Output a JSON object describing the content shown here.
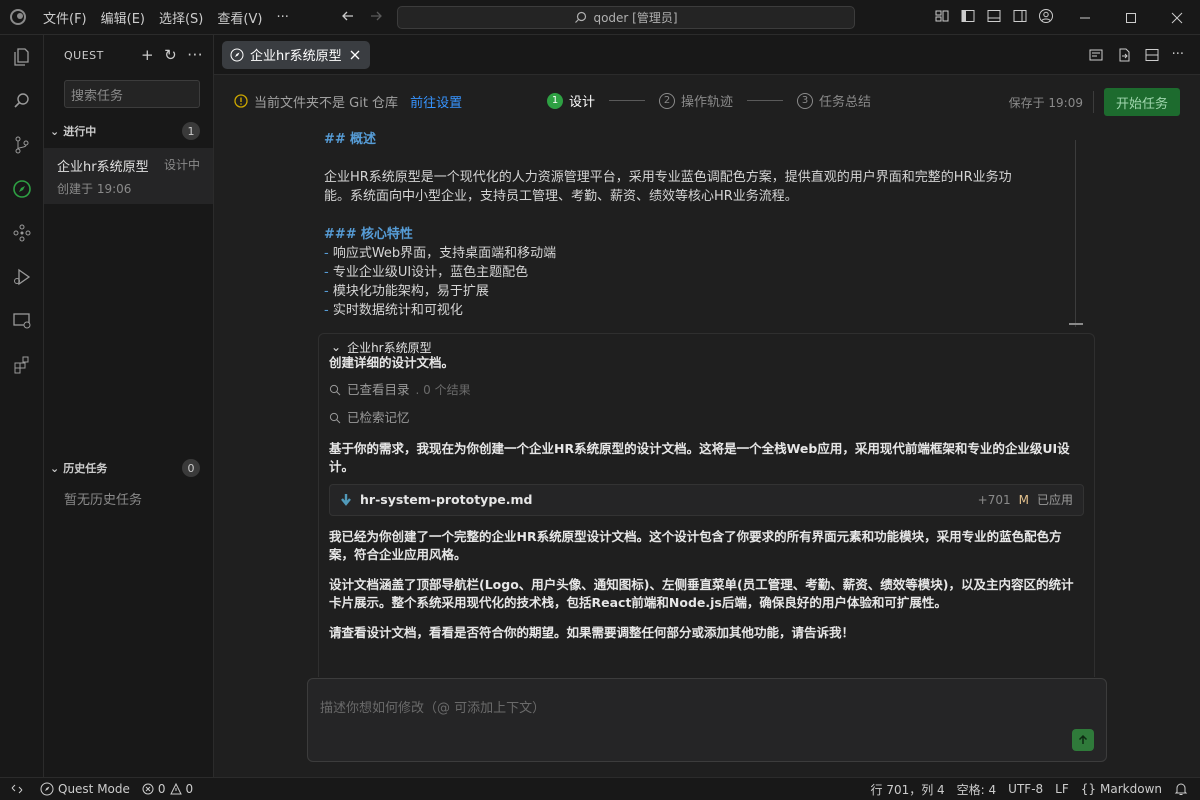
{
  "titlebar": {
    "menu": [
      "文件(F)",
      "编辑(E)",
      "选择(S)",
      "查看(V)",
      "···"
    ],
    "search": "qoder [管理员]"
  },
  "sidebar": {
    "title": "QUEST",
    "search_placeholder": "搜索任务",
    "in_progress": {
      "label": "进行中",
      "count": "1"
    },
    "task": {
      "name": "企业hr系统原型",
      "status": "设计中",
      "created": "创建于 19:06"
    },
    "history": {
      "label": "历史任务",
      "count": "0",
      "empty": "暂无历史任务"
    }
  },
  "tab": {
    "label": "企业hr系统原型"
  },
  "stepbar": {
    "git_warning": "当前文件夹不是 Git 仓库",
    "git_link": "前往设置",
    "steps": [
      {
        "num": "1",
        "label": "设计"
      },
      {
        "num": "2",
        "label": "操作轨迹"
      },
      {
        "num": "3",
        "label": "任务总结"
      }
    ],
    "saved": "保存于 19:09",
    "start_button": "开始任务"
  },
  "doc": {
    "h2_mark": "##",
    "h2_text": "概述",
    "para1_line1": "企业HR系统原型是一个现代化的人力资源管理平台，采用专业蓝色调配色方案，提供直观的用户界面和完整的HR业务功",
    "para1_line2": "能。系统面向中小型企业，支持员工管理、考勤、薪资、绩效等核心HR业务流程。",
    "h3_mark": "###",
    "h3_text": "核心特性",
    "bullets": [
      "响应式Web界面，支持桌面端和移动端",
      "专业企业级UI设计，蓝色主题配色",
      "模块化功能架构，易于扩展",
      "实时数据统计和可视化"
    ]
  },
  "chat": {
    "header": "企业hr系统原型",
    "cut_line": "创建详细的设计文档。",
    "tool1": "已查看目录",
    "tool1_result": ". 0 个结果",
    "tool2": "已检索记忆",
    "para1": "基于你的需求，我现在为你创建一个企业HR系统原型的设计文档。这将是一个全栈Web应用，采用现代前端框架和专业的企业级UI设计。",
    "file": {
      "name": "hr-system-prototype.md",
      "added": "+701",
      "flag": "M",
      "status": "已应用"
    },
    "para2": "我已经为你创建了一个完整的企业HR系统原型设计文档。这个设计包含了你要求的所有界面元素和功能模块，采用专业的蓝色配色方案，符合企业应用风格。",
    "para3": "设计文档涵盖了顶部导航栏(Logo、用户头像、通知图标)、左侧垂直菜单(员工管理、考勤、薪资、绩效等模块)，以及主内容区的统计卡片展示。整个系统采用现代化的技术栈，包括React前端和Node.js后端，确保良好的用户体验和可扩展性。",
    "para4": "请查看设计文档，看看是否符合你的期望。如果需要调整任何部分或添加其他功能，请告诉我！",
    "input_placeholder": "描述你想如何修改（@ 可添加上下文）"
  },
  "statusbar": {
    "mode": "Quest Mode",
    "errors": "0",
    "warnings": "0",
    "position": "行 701，列 4",
    "spaces": "空格: 4",
    "encoding": "UTF-8",
    "eol": "LF",
    "language": "Markdown"
  },
  "colors": {
    "accent_green": "#2ea043",
    "link_blue": "#3794ff",
    "warning_orange": "#cca700",
    "md_heading": "#569cd6"
  }
}
